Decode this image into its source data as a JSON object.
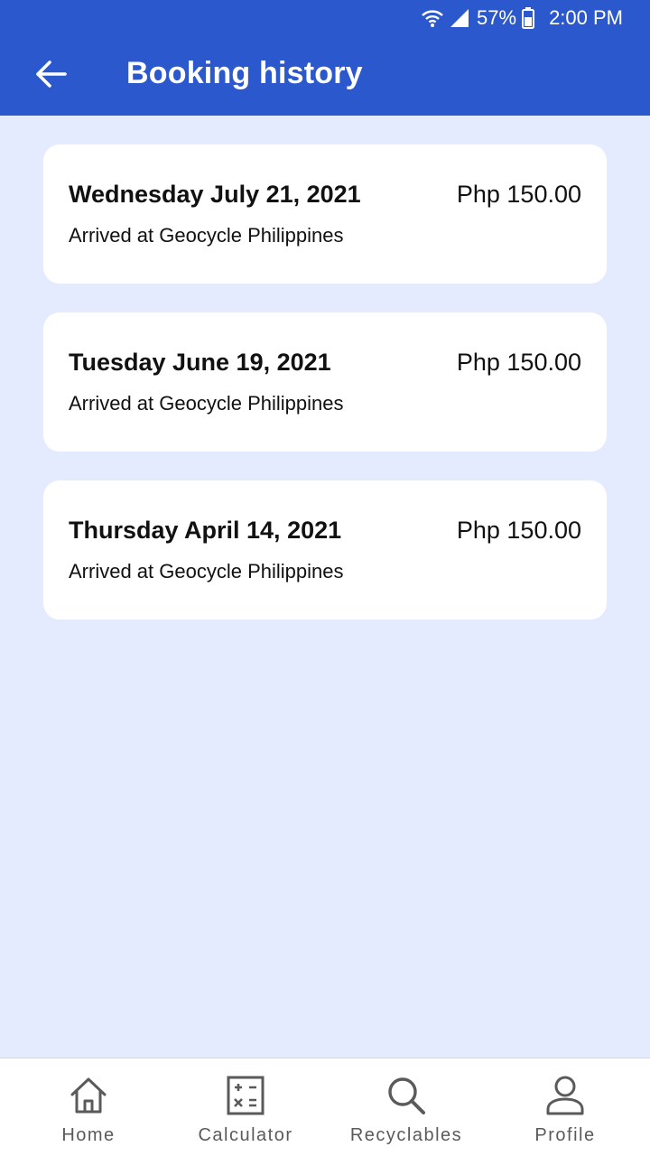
{
  "status_bar": {
    "battery": "57%",
    "time": "2:00 PM",
    "icons": [
      "wifi-icon",
      "cell-signal-icon",
      "battery-icon"
    ]
  },
  "header": {
    "title": "Booking history",
    "back_icon": "arrow-left-icon"
  },
  "bookings": [
    {
      "date": "Wednesday July 21, 2021",
      "price": "Php 150.00",
      "status": "Arrived at Geocycle Philippines"
    },
    {
      "date": "Tuesday June 19, 2021",
      "price": "Php 150.00",
      "status": "Arrived at Geocycle Philippines"
    },
    {
      "date": "Thursday April 14, 2021",
      "price": "Php 150.00",
      "status": "Arrived at Geocycle Philippines"
    }
  ],
  "bottom_nav": {
    "items": [
      {
        "label": "Home",
        "icon": "home-icon"
      },
      {
        "label": "Calculator",
        "icon": "calculator-icon"
      },
      {
        "label": "Recyclables",
        "icon": "search-icon"
      },
      {
        "label": "Profile",
        "icon": "person-icon"
      }
    ]
  },
  "colors": {
    "primary": "#2b58cc",
    "background": "#e5ebfe",
    "card": "#ffffff",
    "nav_icon": "#5a5a5a"
  }
}
